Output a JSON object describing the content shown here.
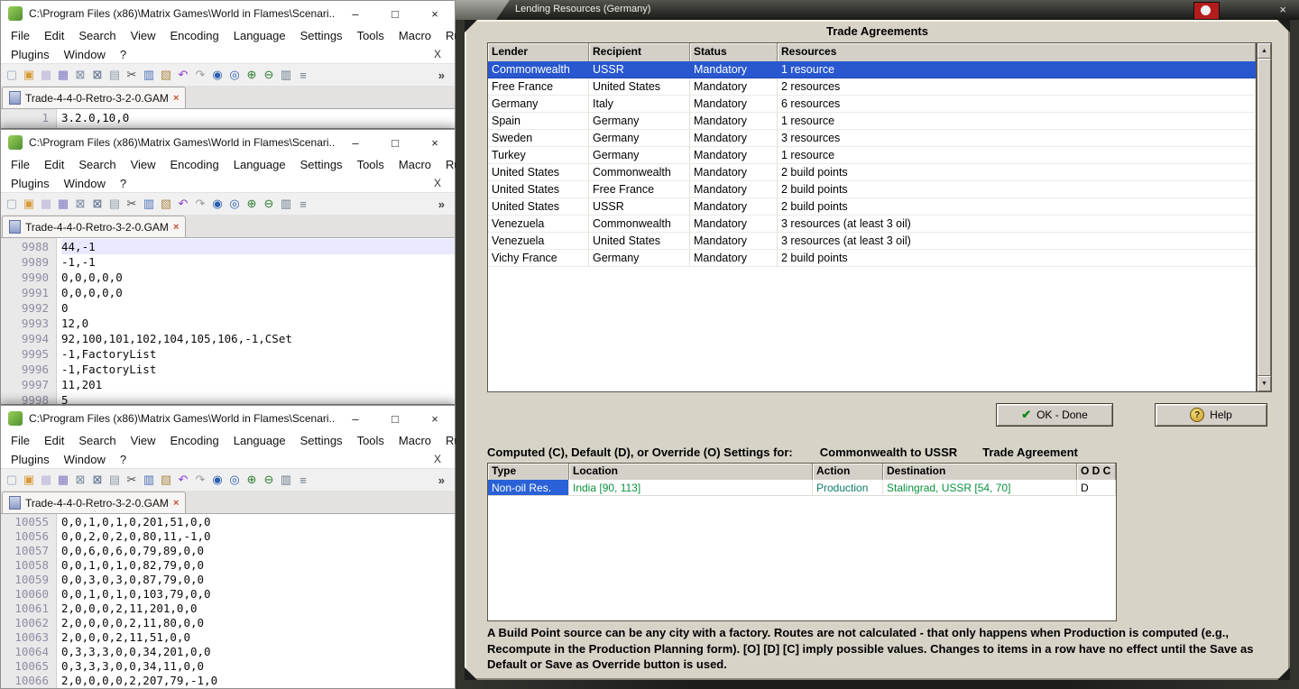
{
  "notepad": {
    "title": "C:\\Program Files (x86)\\Matrix Games\\World in Flames\\Scenari...",
    "minimize": "–",
    "maximize": "□",
    "close": "×",
    "menu1": [
      "File",
      "Edit",
      "Search",
      "View",
      "Encoding",
      "Language",
      "Settings",
      "Tools",
      "Macro",
      "Run"
    ],
    "menu2": [
      "Plugins",
      "Window",
      "?"
    ],
    "menu_close": "X",
    "toolbar_overflow": "»",
    "tab_label": "Trade-4-4-0-Retro-3-2-0.GAM",
    "tab_close": "×",
    "toolbar": [
      {
        "name": "new-file-icon",
        "glyph": "▢",
        "color": "#9aa7b8"
      },
      {
        "name": "open-folder-icon",
        "glyph": "▣",
        "color": "#d79b3c"
      },
      {
        "name": "save-icon",
        "glyph": "▦",
        "color": "#b9b3d8"
      },
      {
        "name": "save-all-icon",
        "glyph": "▦",
        "color": "#7f76c2"
      },
      {
        "name": "close-file-icon",
        "glyph": "⊠",
        "color": "#7a8aa0"
      },
      {
        "name": "close-all-icon",
        "glyph": "⊠",
        "color": "#54688a"
      },
      {
        "name": "print-icon",
        "glyph": "▤",
        "color": "#8e9aa6"
      },
      {
        "name": "cut-icon",
        "glyph": "✂",
        "color": "#4a4a4a"
      },
      {
        "name": "copy-icon",
        "glyph": "▥",
        "color": "#4a6fb5"
      },
      {
        "name": "paste-icon",
        "glyph": "▧",
        "color": "#b08a4a"
      },
      {
        "name": "undo-icon",
        "glyph": "↶",
        "color": "#8a3fd0"
      },
      {
        "name": "redo-icon",
        "glyph": "↷",
        "color": "#9a9a9a"
      },
      {
        "name": "find-icon",
        "glyph": "◉",
        "color": "#2b5fb0"
      },
      {
        "name": "replace-icon",
        "glyph": "◎",
        "color": "#2b5fb0"
      },
      {
        "name": "zoom-in-icon",
        "glyph": "⊕",
        "color": "#2e7d32"
      },
      {
        "name": "zoom-out-icon",
        "glyph": "⊖",
        "color": "#2e7d32"
      },
      {
        "name": "doc-map-icon",
        "glyph": "▥",
        "color": "#6a7a8a"
      },
      {
        "name": "function-list-icon",
        "glyph": "≡",
        "color": "#6a7a8a"
      }
    ],
    "windows": [
      {
        "lines": [
          {
            "n": "1",
            "t": "3.2.0,10,0"
          }
        ]
      },
      {
        "lines": [
          {
            "n": "9988",
            "t": "44,-1",
            "current": true
          },
          {
            "n": "9989",
            "t": "-1,-1"
          },
          {
            "n": "9990",
            "t": "0,0,0,0,0"
          },
          {
            "n": "9991",
            "t": "0,0,0,0,0"
          },
          {
            "n": "9992",
            "t": "0"
          },
          {
            "n": "9993",
            "t": "12,0"
          },
          {
            "n": "9994",
            "t": "92,100,101,102,104,105,106,-1,CSet"
          },
          {
            "n": "9995",
            "t": "-1,FactoryList"
          },
          {
            "n": "9996",
            "t": "-1,FactoryList"
          },
          {
            "n": "9997",
            "t": "11,201"
          },
          {
            "n": "9998",
            "t": "5"
          }
        ]
      },
      {
        "lines": [
          {
            "n": "10055",
            "t": "0,0,1,0,1,0,201,51,0,0"
          },
          {
            "n": "10056",
            "t": "0,0,2,0,2,0,80,11,-1,0"
          },
          {
            "n": "10057",
            "t": "0,0,6,0,6,0,79,89,0,0"
          },
          {
            "n": "10058",
            "t": "0,0,1,0,1,0,82,79,0,0"
          },
          {
            "n": "10059",
            "t": "0,0,3,0,3,0,87,79,0,0"
          },
          {
            "n": "10060",
            "t": "0,0,1,0,1,0,103,79,0,0"
          },
          {
            "n": "10061",
            "t": "2,0,0,0,2,11,201,0,0"
          },
          {
            "n": "10062",
            "t": "2,0,0,0,0,2,11,80,0,0"
          },
          {
            "n": "10063",
            "t": "2,0,0,0,2,11,51,0,0"
          },
          {
            "n": "10064",
            "t": "0,3,3,3,0,0,34,201,0,0"
          },
          {
            "n": "10065",
            "t": "0,3,3,3,0,0,34,11,0,0"
          },
          {
            "n": "10066",
            "t": "2,0,0,0,0,2,207,79,-1,0"
          }
        ]
      }
    ]
  },
  "game": {
    "window_title": "Lending Resources (Germany)",
    "close": "×",
    "heading": "Trade Agreements",
    "colors": {
      "selection_blue": "#2857cf",
      "location_green": "#0a9140",
      "action_teal": "#0c7d68",
      "panel_gray": "#d7d3c7"
    },
    "agreements": {
      "headers": [
        "Lender",
        "Recipient",
        "Status",
        "Resources"
      ],
      "selected_index": 0,
      "rows": [
        [
          "Commonwealth",
          "USSR",
          "Mandatory",
          "1 resource"
        ],
        [
          "Free France",
          "United States",
          "Mandatory",
          "2 resources"
        ],
        [
          "Germany",
          "Italy",
          "Mandatory",
          "6 resources"
        ],
        [
          "Spain",
          "Germany",
          "Mandatory",
          "1 resource"
        ],
        [
          "Sweden",
          "Germany",
          "Mandatory",
          "3 resources"
        ],
        [
          "Turkey",
          "Germany",
          "Mandatory",
          "1 resource"
        ],
        [
          "United States",
          "Commonwealth",
          "Mandatory",
          "2 build points"
        ],
        [
          "United States",
          "Free France",
          "Mandatory",
          "2 build points"
        ],
        [
          "United States",
          "USSR",
          "Mandatory",
          "2 build points"
        ],
        [
          "Venezuela",
          "Commonwealth",
          "Mandatory",
          "3 resources (at least 3 oil)"
        ],
        [
          "Venezuela",
          "United States",
          "Mandatory",
          "3 resources (at least 3 oil)"
        ],
        [
          "Vichy France",
          "Germany",
          "Mandatory",
          "2 build points"
        ]
      ]
    },
    "ok_button": "OK - Done",
    "help_button": "Help",
    "settings_label": "Computed (C), Default (D), or Override (O) Settings for:",
    "settings_pair": "Commonwealth to USSR",
    "settings_kind": "Trade Agreement",
    "settings_table": {
      "headers": [
        "Type",
        "Location",
        "Action",
        "Destination",
        "O D C"
      ],
      "selected_index": 0,
      "rows": [
        [
          "Non-oil Res.",
          "India [90, 113]",
          "Production",
          "Stalingrad, USSR [54, 70]",
          "D"
        ]
      ]
    },
    "footer": "A Build Point source can be any city with a factory. Routes are not calculated - that only happens when Production is computed (e.g., Recompute in the Production Planning form).  [O] [D] [C] imply possible values.  Changes to items in a row have no effect until the Save as Default or Save as Override button is used."
  }
}
